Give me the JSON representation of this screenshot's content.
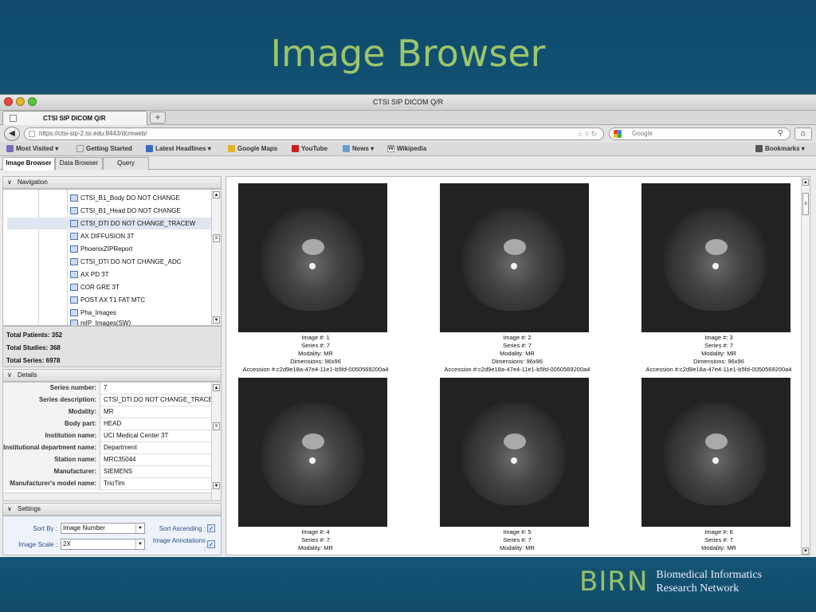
{
  "slide": {
    "title": "Image Browser"
  },
  "window": {
    "title": "CTSI SIP DICOM Q/R"
  },
  "browser": {
    "tab_title": "CTSI SIP DICOM Q/R",
    "new_tab": "+",
    "url": "https://ctsi-sip-2.isi.edu:8443/dcmweb/",
    "search_placeholder": "Google",
    "bookmarks": [
      {
        "label": "Most Visited ▾",
        "icon": "most-visited-icon",
        "color": "#7a6fb8"
      },
      {
        "label": "Getting Started",
        "icon": "page-icon",
        "color": "#dddddd"
      },
      {
        "label": "Latest Headlines ▾",
        "icon": "rss-icon",
        "color": "#3a6cc0"
      },
      {
        "label": "Google Maps",
        "icon": "maps-icon",
        "color": "#e2b22a"
      },
      {
        "label": "YouTube",
        "icon": "youtube-icon",
        "color": "#cc2020"
      },
      {
        "label": "News ▾",
        "icon": "folder-icon",
        "color": "#6a9bd3"
      },
      {
        "label": "Wikipedia",
        "icon": "wikipedia-icon",
        "color": "#ffffff"
      }
    ],
    "bookmarks_menu": "Bookmarks ▾"
  },
  "app_tabs": [
    "Image Browser",
    "Data Browser",
    "Query"
  ],
  "navigation": {
    "header": "Navigation",
    "items": [
      "CTSI_B1_Body DO NOT CHANGE",
      "CTSI_B1_Head DO NOT CHANGE",
      "CTSI_DTI DO NOT CHANGE_TRACEW",
      "AX DIFFUSION 3T",
      "PhoenixZIPReport",
      "CTSI_DTI DO NOT CHANGE_ADC",
      "AX PD 3T",
      "COR GRE 3T",
      "POST AX T1 FAT MTC",
      "Pha_Images",
      "mIP_Images(SW)"
    ],
    "selected_index": 2
  },
  "totals": {
    "patients": "Total Patients: 352",
    "studies": "Total Studies: 368",
    "series": "Total Series: 6978"
  },
  "details": {
    "header": "Details",
    "rows": [
      {
        "label": "Series number:",
        "value": "7"
      },
      {
        "label": "Series description:",
        "value": "CTSI_DTI DO NOT CHANGE_TRACE"
      },
      {
        "label": "Modality:",
        "value": "MR"
      },
      {
        "label": "Body part:",
        "value": "HEAD"
      },
      {
        "label": "Institution name:",
        "value": "UCI Medical Center 3T"
      },
      {
        "label": "Institutional department name:",
        "value": "Department"
      },
      {
        "label": "Station name:",
        "value": "MRC35044"
      },
      {
        "label": "Manufacturer:",
        "value": "SIEMENS"
      },
      {
        "label": "Manufacturer's model name:",
        "value": "TrioTim"
      }
    ]
  },
  "settings": {
    "header": "Settings",
    "sort_by_label": "Sort By :",
    "sort_by_value": "Image Number",
    "image_scale_label": "Image Scale :",
    "image_scale_value": "2X",
    "sort_ascending_label": "Sort Ascending :",
    "sort_ascending": true,
    "image_annotations_label": "Image Annotations :",
    "image_annotations": true
  },
  "images": [
    {
      "num": "Image #: 1",
      "series": "Series #: 7",
      "modality": "Modality: MR",
      "dims": "Dimensions: 96x96",
      "acc": "Accession #:c2d9e18a-47e4-11e1-b5fd-0050569200a4"
    },
    {
      "num": "Image #: 2",
      "series": "Series #: 7",
      "modality": "Modality: MR",
      "dims": "Dimensions: 96x96",
      "acc": "Accession #:c2d9e18a-47e4-11e1-b5fd-0050569200a4"
    },
    {
      "num": "Image #: 3",
      "series": "Series #: 7",
      "modality": "Modality: MR",
      "dims": "Dimensions: 96x96",
      "acc": "Accession #:c2d9e18a-47e4-11e1-b5fd-0050569200a4"
    },
    {
      "num": "Image #: 4",
      "series": "Series #: 7",
      "modality": "Modality: MR",
      "dims": "",
      "acc": ""
    },
    {
      "num": "Image #: 5",
      "series": "Series #: 7",
      "modality": "Modality: MR",
      "dims": "",
      "acc": ""
    },
    {
      "num": "Image #: 6",
      "series": "Series #: 7",
      "modality": "Modality: MR",
      "dims": "",
      "acc": ""
    }
  ],
  "footer": {
    "logo": "BIRN",
    "line1": "Biomedical Informatics",
    "line2": "Research Network"
  }
}
